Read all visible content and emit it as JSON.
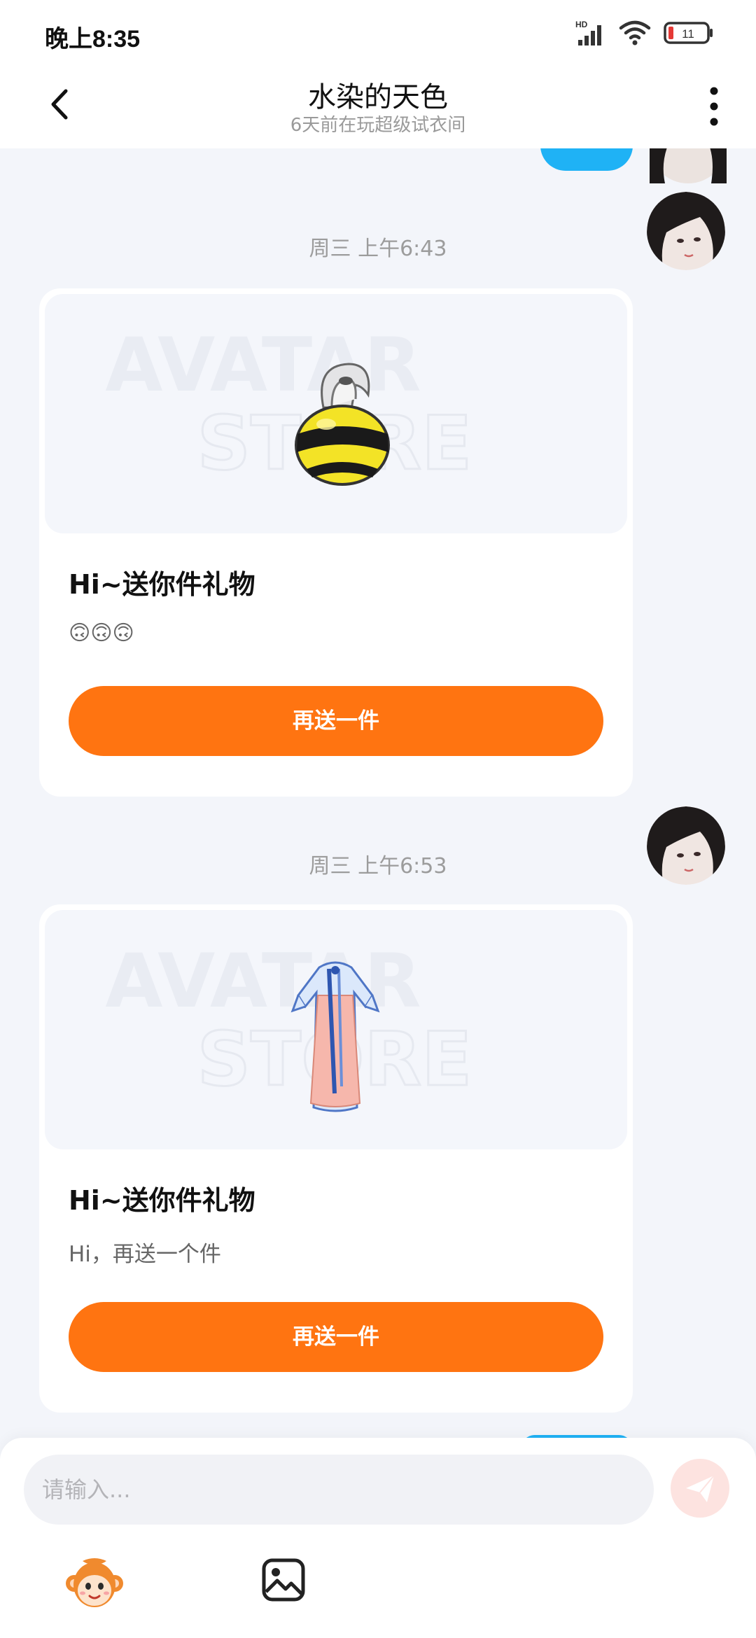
{
  "status_bar": {
    "time": "晚上8:35",
    "network_label": "HD",
    "battery_level": "11",
    "battery_color": "#e53935"
  },
  "header": {
    "title": "水染的天色",
    "subtitle": "6天前在玩超级试衣间"
  },
  "watermark": {
    "line1": "AVATAR",
    "line2": "STORE"
  },
  "messages": [
    {
      "timestamp": "周三 上午6:43",
      "card_title": "Hi~送你件礼物",
      "card_message": "🙃🙃🙃",
      "item_icon": "bee-bag-icon",
      "button_label": "再送一件"
    },
    {
      "timestamp": "周三 上午6:53",
      "card_title": "Hi~送你件礼物",
      "card_message": "Hi，再送一个件",
      "item_icon": "blue-robe-dress-icon",
      "button_label": "再送一件"
    }
  ],
  "input": {
    "placeholder": "请输入..."
  },
  "colors": {
    "accent": "#ff7411",
    "bubble_blue": "#1fb2f5",
    "send_disabled": "#fde3e0",
    "background": "#f3f5fa"
  }
}
